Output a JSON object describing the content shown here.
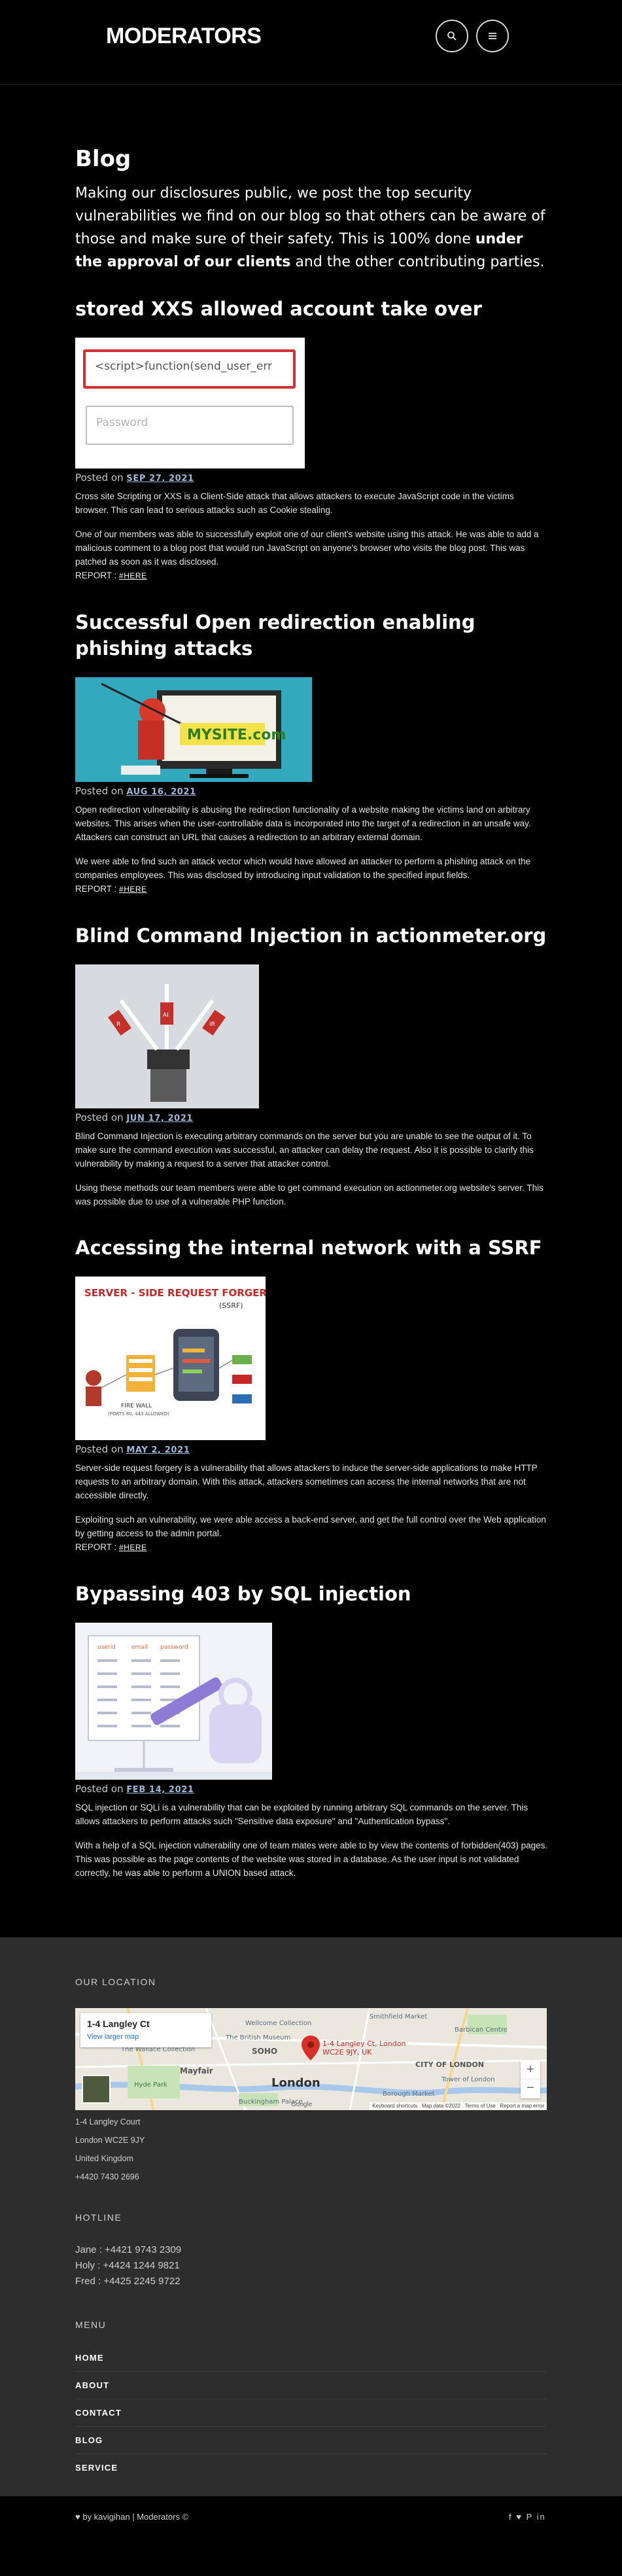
{
  "header": {
    "logo": "MODERATORS",
    "search_icon": "search-icon",
    "menu_icon": "menu-icon"
  },
  "page": {
    "title": "Blog",
    "intro_text_1": "Making our disclosures public, we post the top security vulnerabilities we find on our blog so that others can be aware of those and make sure of their safety. This is 100% done ",
    "intro_bold": "under the approval of our clients",
    "intro_text_2": " and the other contributing parties."
  },
  "posts": [
    {
      "title": "stored XXS allowed account take over",
      "image_input_1": "<script>function(send_user_err",
      "image_input_2": "Password",
      "posted_label": "Posted on",
      "date": "SEP 27, 2021",
      "paragraphs": [
        "Cross site Scripting or XXS is a Client-Side attack that allows attackers to execute JavaScript code in the victims browser. This can lead to serious attacks such as Cookie stealing.",
        "One of our members was able to successfully exploit one of our client's website using this attack. He was able to add a malicious comment to a blog post that would run JavaScript on anyone's browser who visits the blog post. This was patched as soon as it was disclosed."
      ],
      "report_label": "REPORT :",
      "report_link": "#HERE"
    },
    {
      "title": "Successful Open redirection enabling phishing attacks",
      "image_text": "MYSITE.com",
      "posted_label": "Posted on",
      "date": "AUG 16, 2021",
      "paragraphs": [
        "Open redirection vulnerability is abusing the redirection functionality of a website making the victims land on arbitrary websites. This arises when the user-controllable data is incorporated into the target of a redirection in an unsafe way. Attackers can construct an URL that causes a redirection to an arbitrary external domain.",
        "We were able to find such an attack vector which would have allowed an attacker to perform a phishing attack on the companies employees. This was disclosed by introducing input validation to the specified input fields."
      ],
      "report_label": "REPORT :",
      "report_link": "#HERE"
    },
    {
      "title": "Blind Command Injection in actionmeter.org",
      "image_tags": [
        "R",
        "AI",
        "IR"
      ],
      "posted_label": "Posted on",
      "date": "JUN 17, 2021",
      "paragraphs": [
        "Blind Command Injection is executing arbitrary commands on the server but you are unable to see the output of it. To make sure the command execution was successful, an attacker can delay the request. Also it is possible to clarify this vulnerability by making a request to a server that attacker control.",
        "Using these methods our team members were able to get command execution on actionmeter.org website's server. This was possible due to use of a vulnerable PHP function."
      ]
    },
    {
      "title": "Accessing the internal network with a SSRF",
      "image_title": "SERVER - SIDE REQUEST FORGERY",
      "image_subtitle": "(SSRF)",
      "image_label": "FIRE WALL",
      "image_sublabel": "(PORTS 80, 443 ALLOWED)",
      "posted_label": "Posted on",
      "date": "MAY 2, 2021",
      "paragraphs": [
        "Server-side request forgery is a vulnerability that allows attackers to induce the server-side applications to make HTTP requests to an arbitrary domain. With this attack, attackers sometimes can access the internal networks that are not accessible directly.",
        "Exploiting such an vulnerability, we were able access a back-end server, and get the full control over the Web application by getting access to the admin portal."
      ],
      "report_label": "REPORT :",
      "report_link": "#HERE"
    },
    {
      "title": "Bypassing 403 by SQL injection",
      "image_cols": [
        "userid",
        "email",
        "password"
      ],
      "posted_label": "Posted on",
      "date": "FEB 14, 2021",
      "paragraphs": [
        "SQL injection or SQLi is a vulnerability that can be exploited by running arbitrary SQL commands on the server. This allows attackers to perform attacks such \"Sensitive data exposure\" and \"Authentication bypass\".",
        "With a help of a SQL injection vulnerability one of team mates were able to by view the contents of forbidden(403) pages. This was possible as the page contents of the website was stored in a database. As the user input is not validated correctly, he was able to perform a UNION based attack."
      ]
    }
  ],
  "footer": {
    "location_heading": "OUR LOCATION",
    "map": {
      "place": "1-4 Langley Ct",
      "larger_map": "View larger map",
      "pin_label_1": "1-4 Langley Ct, London",
      "pin_label_2": "WC2E 9JY, UK",
      "labels": [
        "Smithfield Market",
        "Barbican Centre",
        "Wellcome Collection",
        "The Wallace Collection",
        "Mayfair",
        "SOHO",
        "London",
        "CITY OF LONDON",
        "Tower of London",
        "Hyde Park",
        "Buckingham Palace",
        "Borough Market",
        "The British Museum",
        "Google"
      ],
      "footer_text": "Keyboard shortcuts   Map data ©2022   Terms of Use   Report a map error",
      "zoom_in": "+",
      "zoom_out": "−"
    },
    "address": [
      "1-4 Langley Court",
      "London WC2E 9JY",
      "United Kingdom",
      "+4420 7430 2696"
    ],
    "hotline_heading": "HOTLINE",
    "hotline": [
      "Jane : +4421 9743 2309",
      "Holy : +4424 1244 9821",
      "Fred : +4425 2245 9722"
    ],
    "menu_heading": "MENU",
    "menu": [
      "HOME",
      "ABOUT",
      "CONTACT",
      "BLOG",
      "SERVICE"
    ],
    "credit": "by kavigihan | Moderators ©",
    "social": [
      "f",
      "♥",
      "P",
      "in"
    ]
  }
}
